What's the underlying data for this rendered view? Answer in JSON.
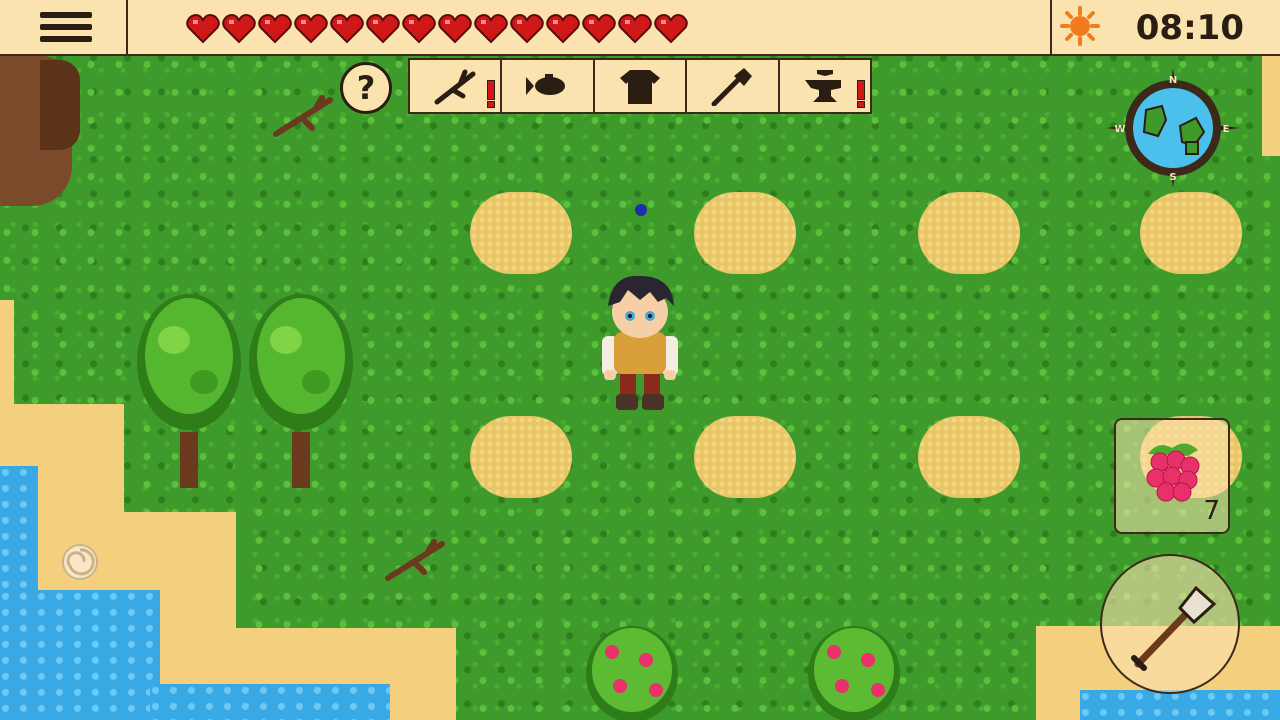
{
  "hud": {
    "health_hearts": 14,
    "health_max": 14,
    "time": "08:10",
    "weather_icon": "sun-icon",
    "colors": {
      "hud_bg": "#fbe3b0",
      "heart": "#d01818",
      "sun": "#f07c1e",
      "alert": "#d01818"
    }
  },
  "help": {
    "label": "?"
  },
  "crafting_tabs": [
    {
      "icon": "branch-icon",
      "alert": true
    },
    {
      "icon": "fish-icon",
      "alert": false
    },
    {
      "icon": "shirt-icon",
      "alert": false
    },
    {
      "icon": "shovel-icon",
      "alert": false
    },
    {
      "icon": "anvil-icon",
      "alert": true
    }
  ],
  "minimap": {
    "compass_labels": [
      "N",
      "E",
      "S",
      "W"
    ]
  },
  "inventory": {
    "item_icon": "raspberry-icon",
    "count": "7"
  },
  "action": {
    "tool_icon": "shovel-icon"
  },
  "terrain": {
    "grass": "#3f9a2c",
    "sand": "#f3cf7e",
    "water": "#39a9e6",
    "dirt": "#e8c566"
  }
}
